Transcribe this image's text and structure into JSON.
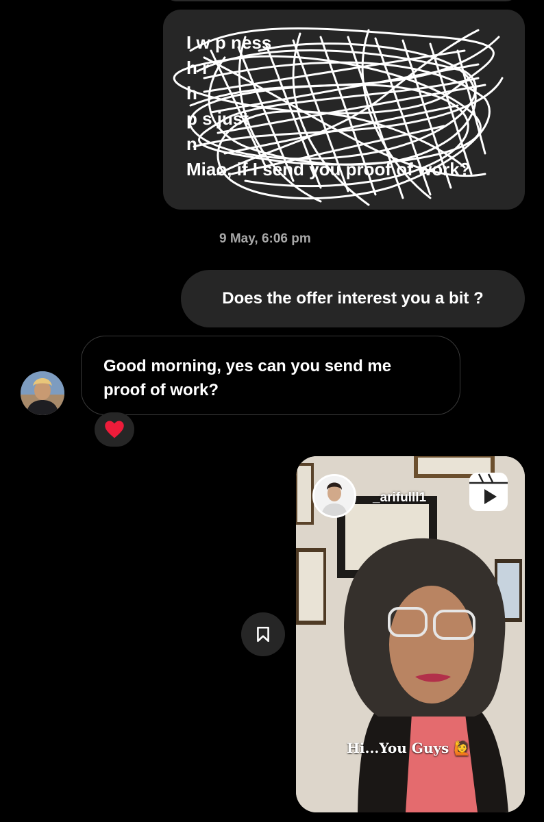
{
  "conversation": {
    "sent_message_1": {
      "text": "I w      p              ness\nh                              r\nh\np                   s          just\nn\nMiao, if I send you proof of work?"
    },
    "timestamp": "9 May, 6:06 pm",
    "sent_message_2": {
      "text": "Does the offer interest you a bit ?"
    },
    "received_message": {
      "text": "Good morning, yes can you send me proof of work?"
    },
    "reaction": {
      "icon": "heart-icon",
      "color": "#ed1c3a"
    },
    "shared_reel": {
      "username": "_arifulll1",
      "caption": "Hi...You Guys 🙋",
      "icon": "reels-icon"
    },
    "save_button": {
      "icon": "bookmark-icon"
    }
  },
  "colors": {
    "background": "#000000",
    "bubble": "#262626",
    "timestamp": "#a8a8a8"
  }
}
